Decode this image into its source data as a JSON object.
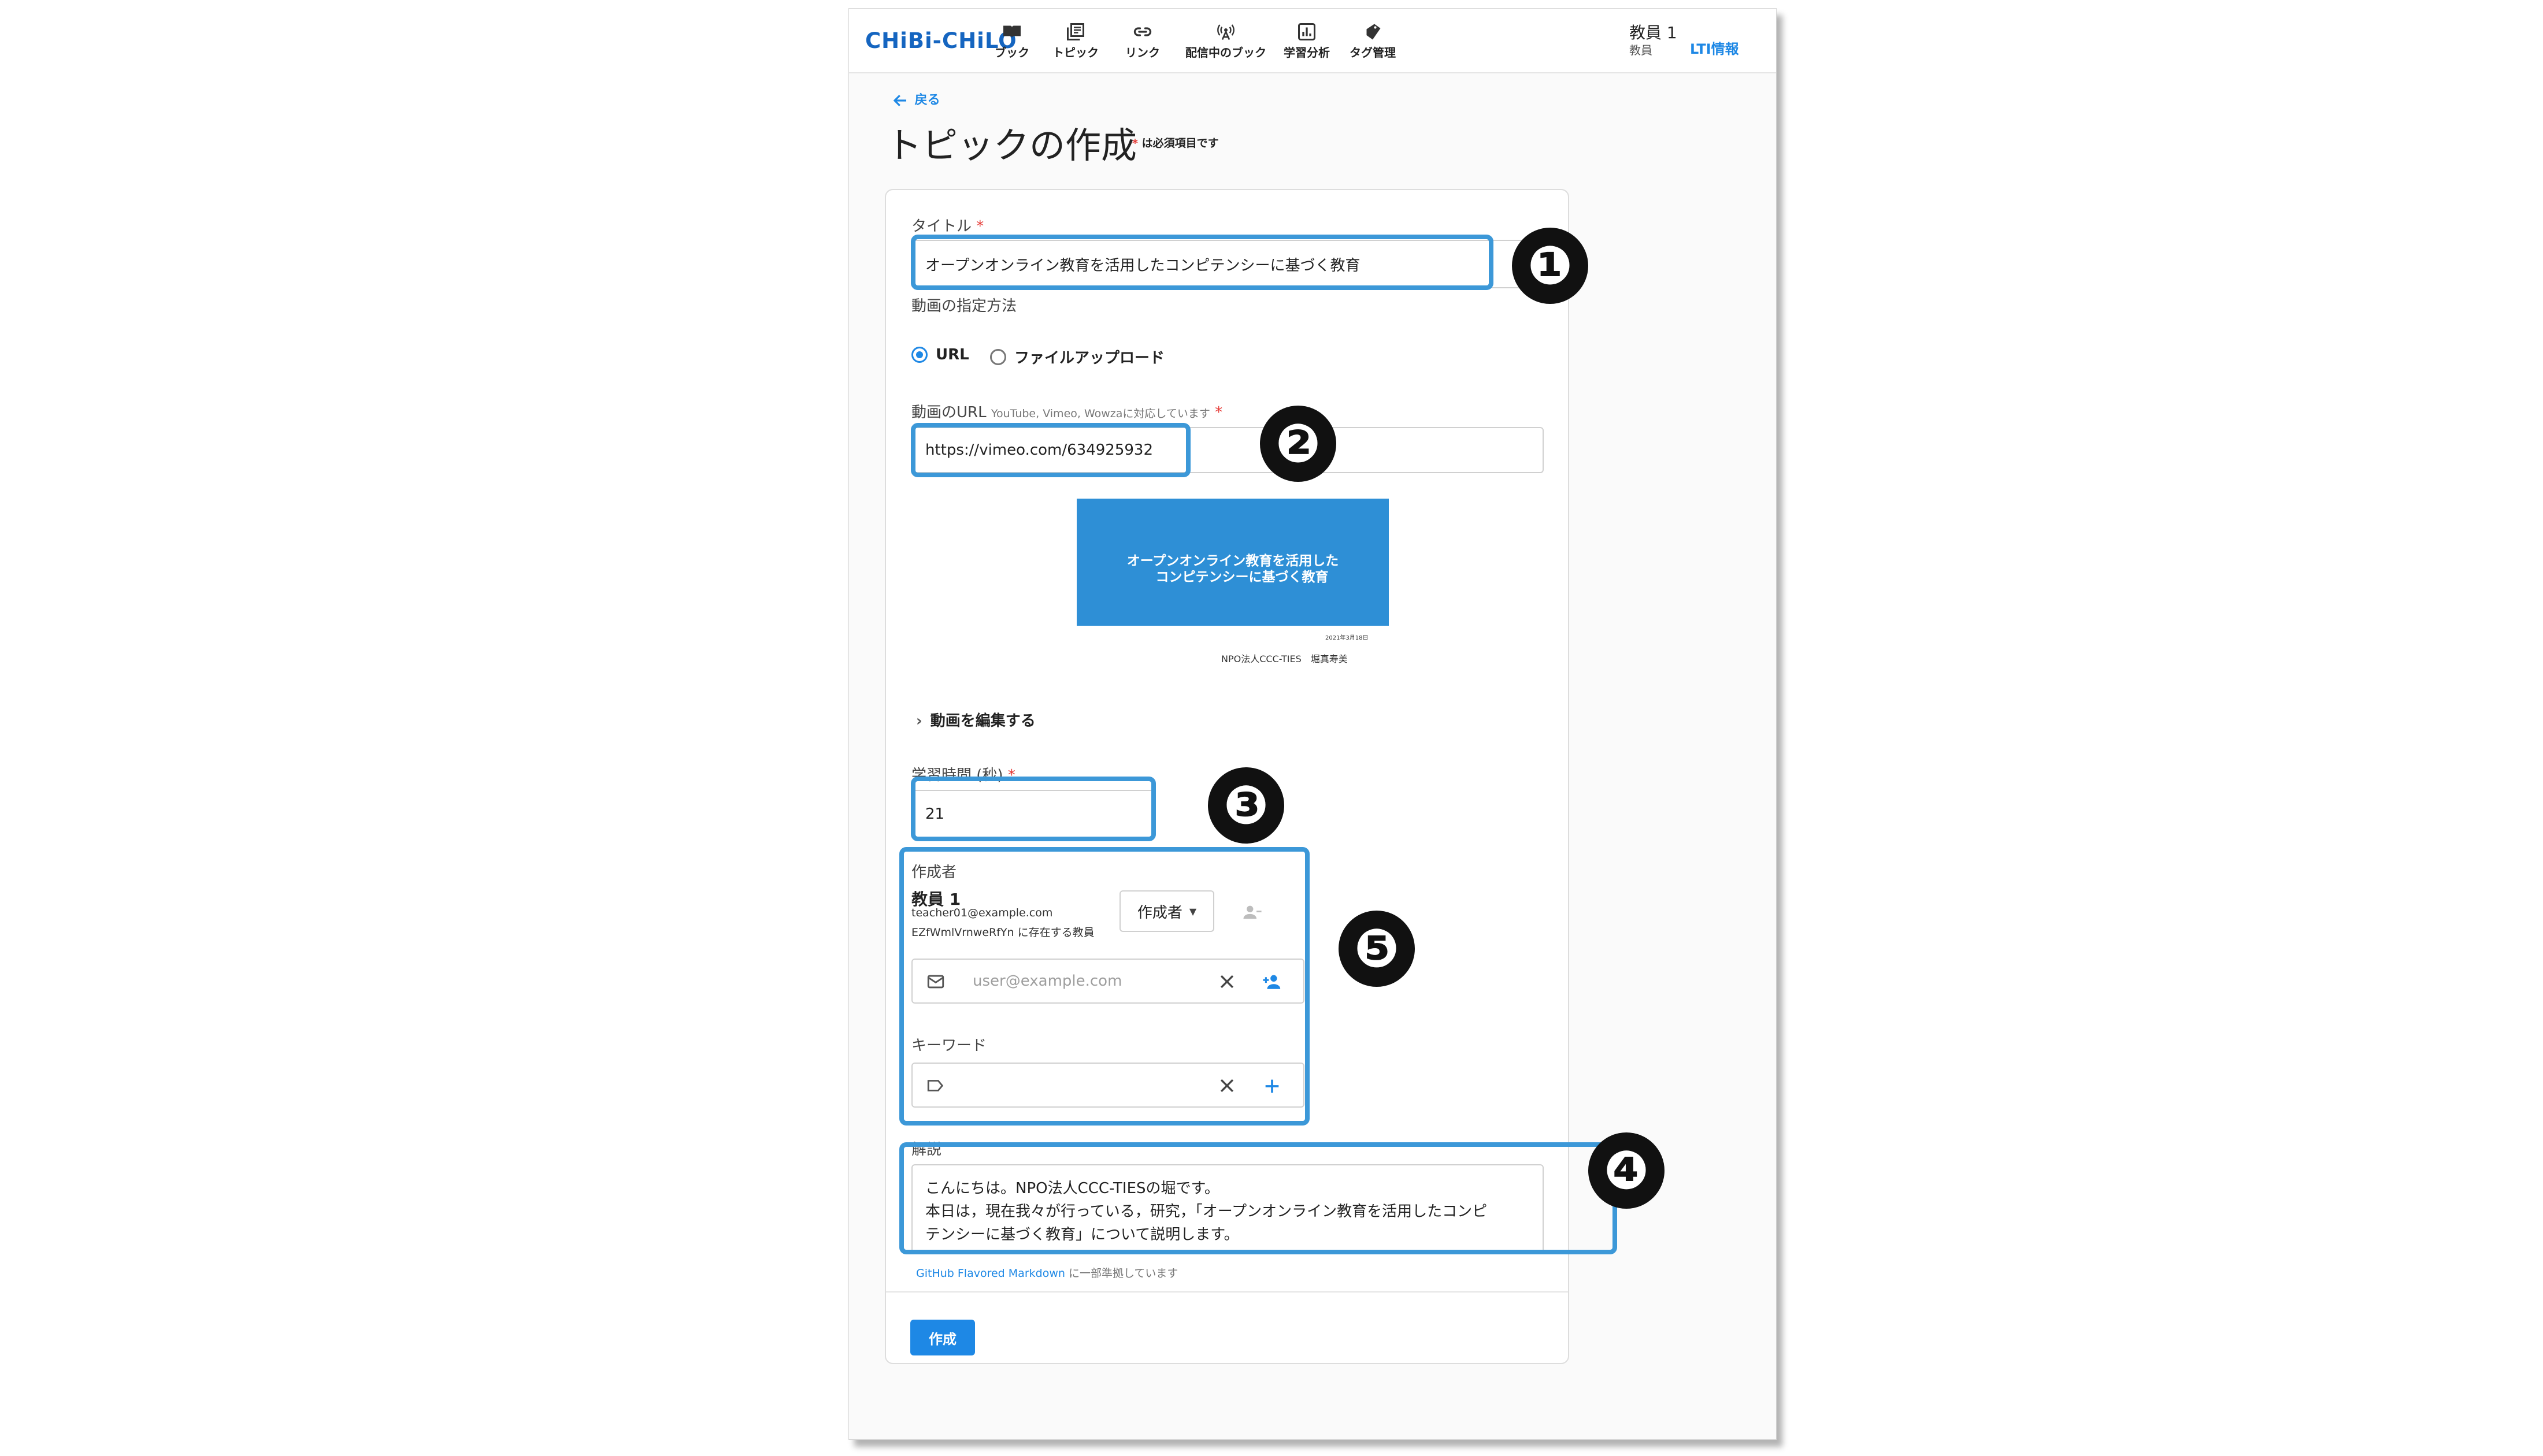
{
  "header": {
    "logo": "CHiBi-CHiLO",
    "nav": [
      {
        "label": "ブック",
        "icon": "book-icon"
      },
      {
        "label": "トピック",
        "icon": "library-icon"
      },
      {
        "label": "リンク",
        "icon": "link-icon"
      },
      {
        "label": "配信中のブック",
        "icon": "broadcast-icon"
      },
      {
        "label": "学習分析",
        "icon": "analytics-icon"
      },
      {
        "label": "タグ管理",
        "icon": "tag-icon"
      }
    ],
    "user": {
      "name": "教員 1",
      "role": "教員"
    },
    "lti_label": "LTI情報"
  },
  "page": {
    "back_label": "戻る",
    "title": "トピックの作成",
    "required_note": "は必須項目です"
  },
  "form": {
    "title": {
      "label": "タイトル",
      "value": "オープンオンライン教育を活用したコンピテンシーに基づく教育"
    },
    "video_method": {
      "label": "動画の指定方法",
      "options": [
        "URL",
        "ファイルアップロード"
      ],
      "selected": "URL"
    },
    "video_url": {
      "label": "動画のURL",
      "hint": "YouTube, Vimeo, Wowzaに対応しています",
      "value": "https://vimeo.com/634925932"
    },
    "video_preview": {
      "line1": "オープンオンライン教育を活用した",
      "line2": "コンピテンシーに基づく教育",
      "date": "2021年3月18日",
      "caption": "NPO法人CCC-TIES　堀真寿美"
    },
    "edit_video_label": "動画を編集する",
    "duration": {
      "label": "学習時間 (秒)",
      "value": "21"
    },
    "authors": {
      "label": "作成者",
      "name": "教員 1",
      "email": "teacher01@example.com",
      "org": "EZfWmlVrnweRfYn に存在する教員",
      "role": "作成者",
      "email_placeholder": "user@example.com"
    },
    "keywords": {
      "label": "キーワード",
      "placeholder": ""
    },
    "description": {
      "label": "解説",
      "lines": [
        "こんにちは。NPO法人CCC-TIESの堀です。",
        "本日は，現在我々が行っている，研究，「オープンオンライン教育を活用したコンピ",
        "テンシーに基づく教育」について説明します。"
      ]
    },
    "markdown_link": "GitHub Flavored Markdown",
    "markdown_note": "に一部準拠しています",
    "submit_label": "作成"
  },
  "annotations": [
    "❶",
    "❷",
    "❸",
    "❹",
    "❺"
  ],
  "colors": {
    "accent": "#1e88e5",
    "highlight": "#3c98d8",
    "required": "#e53935",
    "thumbnail": "#2e8fd6"
  }
}
